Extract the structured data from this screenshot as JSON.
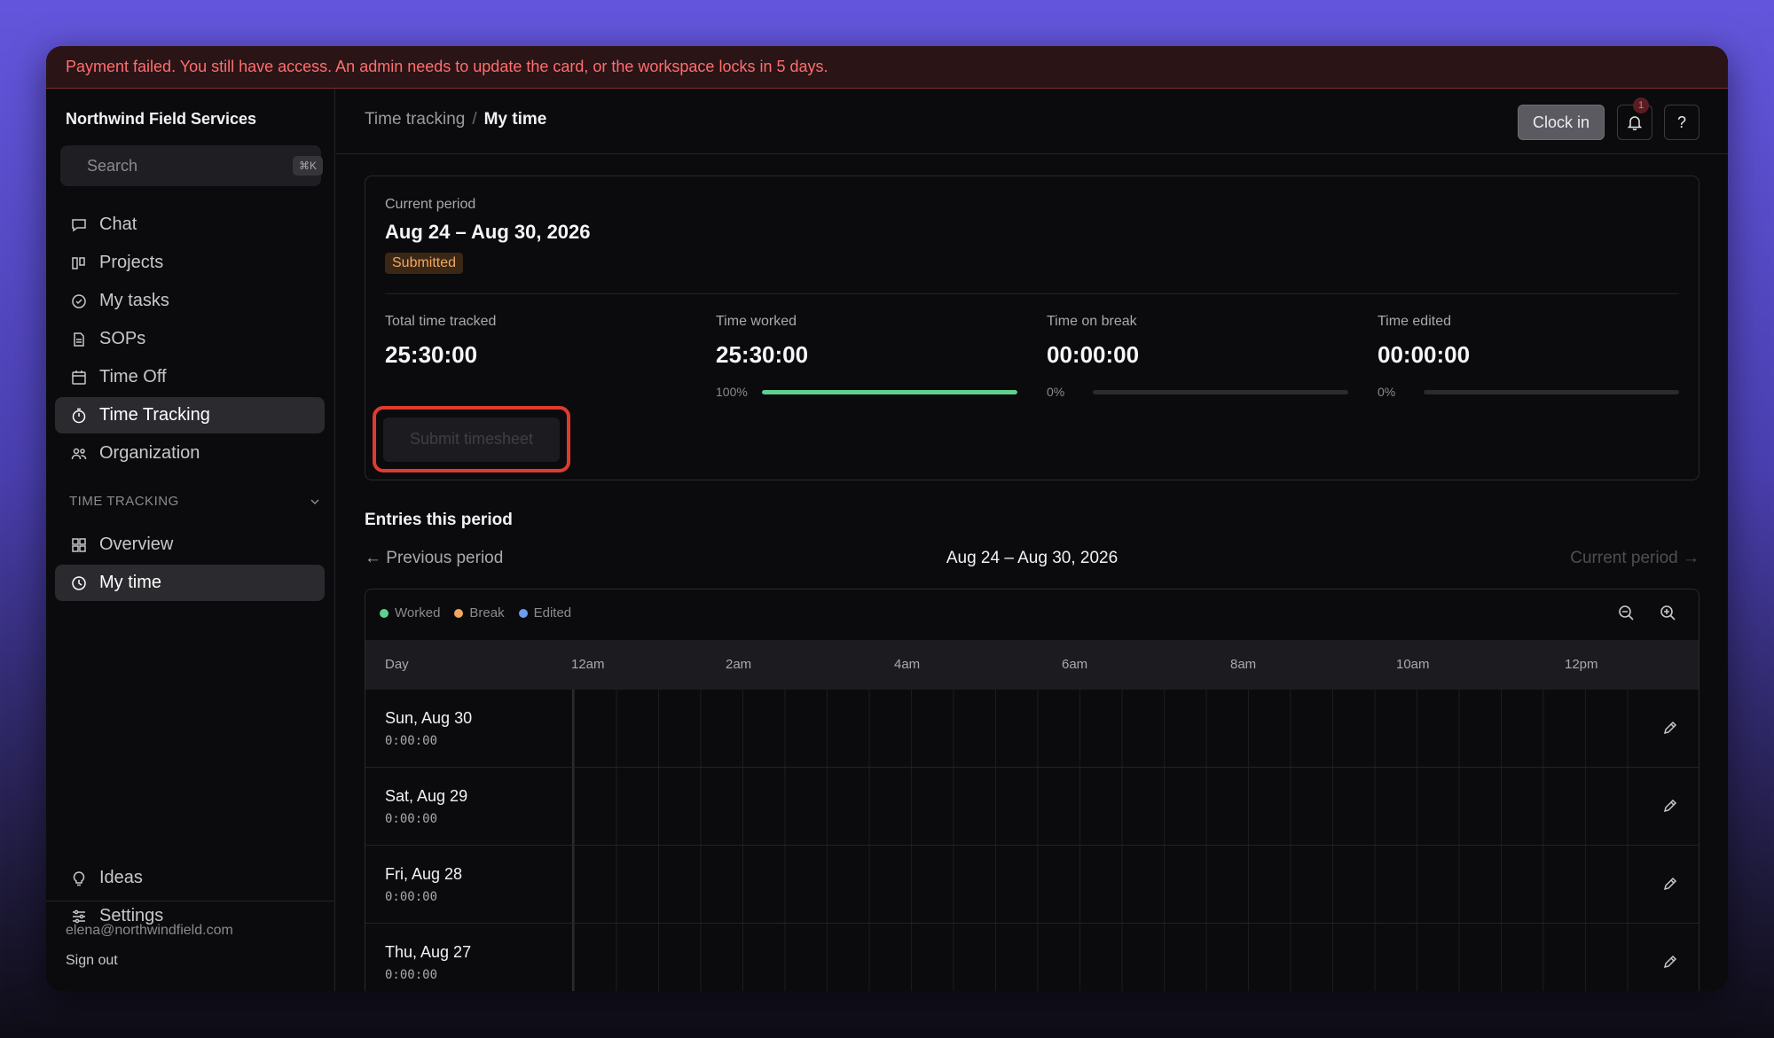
{
  "banner": {
    "text": "Payment failed. You still have access. An admin needs to update the card, or the workspace locks in 5 days."
  },
  "sidebar": {
    "workspace": "Northwind Field Services",
    "search_placeholder": "Search",
    "search_shortcut": "⌘K",
    "items": [
      {
        "label": "Chat",
        "icon": "chat-icon"
      },
      {
        "label": "Projects",
        "icon": "projects-icon"
      },
      {
        "label": "My tasks",
        "icon": "check-circle-icon"
      },
      {
        "label": "SOPs",
        "icon": "document-icon"
      },
      {
        "label": "Time Off",
        "icon": "calendar-icon"
      },
      {
        "label": "Time Tracking",
        "icon": "stopwatch-icon",
        "active": true
      },
      {
        "label": "Organization",
        "icon": "people-icon"
      }
    ],
    "section_label": "TIME TRACKING",
    "section_items": [
      {
        "label": "Overview",
        "icon": "grid-icon"
      },
      {
        "label": "My time",
        "icon": "clock-icon",
        "active": true
      }
    ],
    "bottom_items": [
      {
        "label": "Ideas",
        "icon": "lightbulb-icon"
      },
      {
        "label": "Settings",
        "icon": "sliders-icon"
      }
    ],
    "email": "elena@northwindfield.com",
    "sign_out": "Sign out"
  },
  "header": {
    "breadcrumb_parent": "Time tracking",
    "breadcrumb_sep": "/",
    "breadcrumb_current": "My time",
    "clock_in": "Clock in",
    "notification_count": "1",
    "help": "?"
  },
  "period": {
    "label": "Current period",
    "range": "Aug 24 – Aug 30, 2026",
    "status": "Submitted",
    "stats": [
      {
        "label": "Total time tracked",
        "value": "25:30:00"
      },
      {
        "label": "Time worked",
        "value": "25:30:00",
        "pct_label": "100%",
        "pct": 1.0
      },
      {
        "label": "Time on break",
        "value": "00:00:00",
        "pct_label": "0%",
        "pct": 0
      },
      {
        "label": "Time edited",
        "value": "00:00:00",
        "pct_label": "0%",
        "pct": 0
      }
    ],
    "submit": "Submit timesheet"
  },
  "entries": {
    "title": "Entries this period",
    "prev": "Previous period",
    "range": "Aug 24 – Aug 30, 2026",
    "next": "Current period",
    "legend": [
      {
        "label": "Worked",
        "color": "#5fd08e"
      },
      {
        "label": "Break",
        "color": "#f0a860"
      },
      {
        "label": "Edited",
        "color": "#6a9ef0"
      }
    ],
    "day_header": "Day",
    "hours": [
      "12am",
      "2am",
      "4am",
      "6am",
      "8am",
      "10am",
      "12pm"
    ],
    "rows": [
      {
        "date": "Sun, Aug 30",
        "duration": "0:00:00"
      },
      {
        "date": "Sat, Aug 29",
        "duration": "0:00:00"
      },
      {
        "date": "Fri, Aug 28",
        "duration": "0:00:00"
      },
      {
        "date": "Thu, Aug 27",
        "duration": "0:00:00"
      }
    ]
  },
  "colors": {
    "accent_worked": "#5fd08e",
    "status_submitted": "#f0a860",
    "banner_error": "#ff6e6e"
  }
}
